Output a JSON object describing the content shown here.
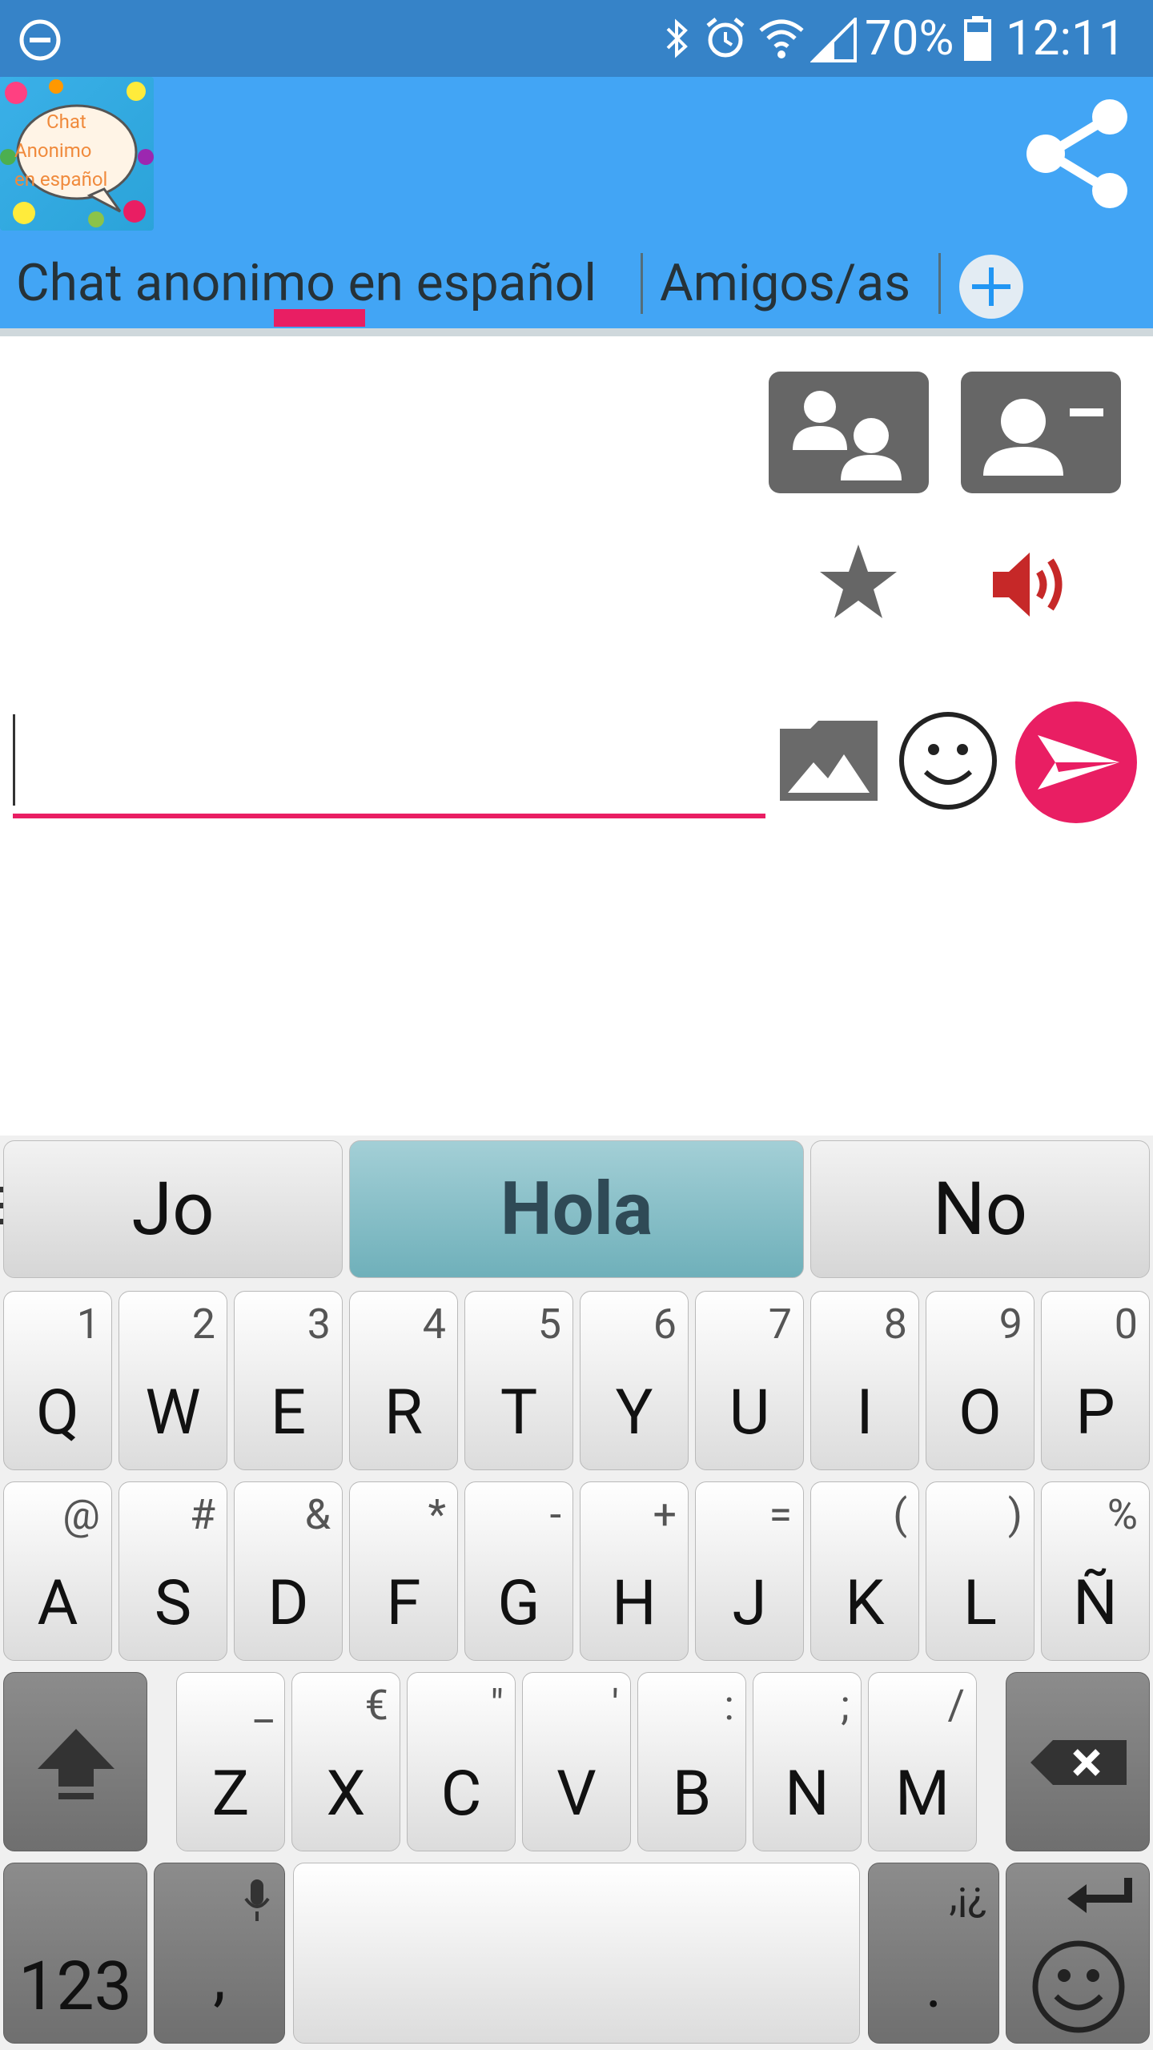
{
  "status_bar": {
    "battery": "70%",
    "time": "12:11"
  },
  "app": {
    "logo_text": [
      "Chat",
      "Anonimo",
      "en español"
    ],
    "tabs": [
      {
        "label": "Chat anonimo en español",
        "selected": true
      },
      {
        "label": "Amigos/as",
        "selected": false
      }
    ]
  },
  "actions": {
    "group_users_icon": "users-group-icon",
    "remove_user_icon": "user-minus-icon",
    "favorite_icon": "star-icon",
    "sound_icon": "speaker-icon"
  },
  "composer": {
    "value": "",
    "placeholder": ""
  },
  "keyboard": {
    "suggestions": [
      "Jo",
      "Hola",
      "No"
    ],
    "row1": [
      {
        "k": "Q",
        "h": "1"
      },
      {
        "k": "W",
        "h": "2"
      },
      {
        "k": "E",
        "h": "3"
      },
      {
        "k": "R",
        "h": "4"
      },
      {
        "k": "T",
        "h": "5"
      },
      {
        "k": "Y",
        "h": "6"
      },
      {
        "k": "U",
        "h": "7"
      },
      {
        "k": "I",
        "h": "8"
      },
      {
        "k": "O",
        "h": "9"
      },
      {
        "k": "P",
        "h": "0"
      }
    ],
    "row2": [
      {
        "k": "A",
        "h": "@"
      },
      {
        "k": "S",
        "h": "#"
      },
      {
        "k": "D",
        "h": "&"
      },
      {
        "k": "F",
        "h": "*"
      },
      {
        "k": "G",
        "h": "-"
      },
      {
        "k": "H",
        "h": "+"
      },
      {
        "k": "J",
        "h": "="
      },
      {
        "k": "K",
        "h": "("
      },
      {
        "k": "L",
        "h": ")"
      },
      {
        "k": "Ñ",
        "h": "%"
      }
    ],
    "row3": [
      {
        "k": "Z",
        "h": "_"
      },
      {
        "k": "X",
        "h": "€"
      },
      {
        "k": "C",
        "h": "\""
      },
      {
        "k": "V",
        "h": "'"
      },
      {
        "k": "B",
        "h": ":"
      },
      {
        "k": "N",
        "h": ";"
      },
      {
        "k": "M",
        "h": "/"
      }
    ],
    "num_key": "123",
    "comma_key": ",",
    "period_key": ".",
    "period_hint": ",¡¿"
  }
}
